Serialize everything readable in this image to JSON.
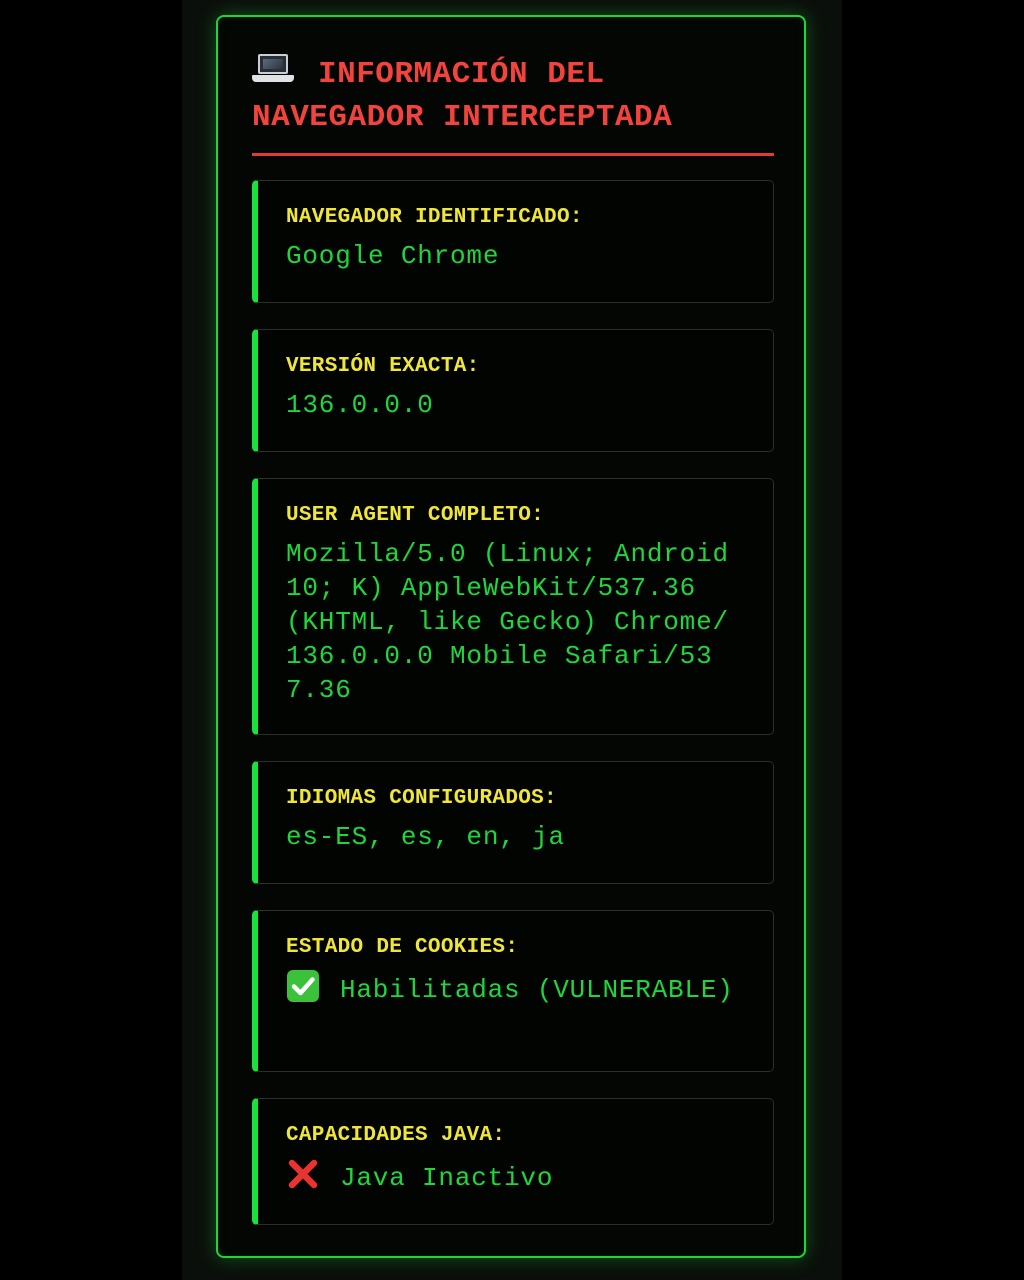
{
  "header": {
    "title": "INFORMACIÓN DEL NAVEGADOR INTERCEPTADA",
    "icon": "laptop-icon"
  },
  "cards": [
    {
      "label": "NAVEGADOR IDENTIFICADO:",
      "value": "Google Chrome"
    },
    {
      "label": "VERSIÓN EXACTA:",
      "value": "136.0.0.0"
    },
    {
      "label": "USER AGENT COMPLETO:",
      "value": "Mozilla/5.0 (Linux; Android 10; K) AppleWebKit/537.36 (KHTML, like Gecko) Chrome/136.0.0.0 Mobile Safari/537.36"
    },
    {
      "label": "IDIOMAS CONFIGURADOS:",
      "value": "es-ES, es, en, ja"
    },
    {
      "label": "ESTADO DE COOKIES:",
      "value": "Habilitadas (VULNERABLE)",
      "icon": "check-mark-icon"
    },
    {
      "label": "CAPACIDADES JAVA:",
      "value": "Java Inactivo",
      "icon": "cross-mark-icon"
    }
  ],
  "colors": {
    "accent_green": "#1fd63c",
    "title_red": "#f2433c",
    "label_yellow": "#f0e63a",
    "background": "#000000"
  }
}
